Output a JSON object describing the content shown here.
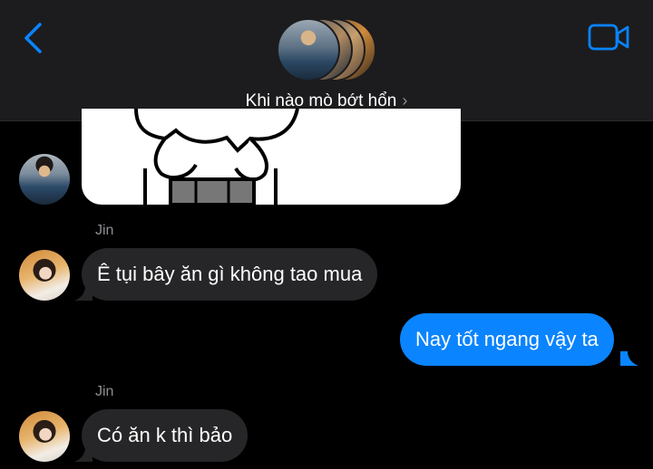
{
  "header": {
    "title": "Khi nào mò bớt hổn",
    "back_icon": "chevron-left-icon",
    "video_icon": "video-camera-icon",
    "accent": "#0a84ff"
  },
  "messages": [
    {
      "type": "image",
      "direction": "incoming",
      "avatar": "boy"
    },
    {
      "sender": "Jin",
      "text": "Ê tụi bây ăn gì không tao mua",
      "direction": "incoming",
      "avatar": "girl"
    },
    {
      "text": "Nay tốt ngang vậy ta",
      "direction": "outgoing"
    },
    {
      "sender": "Jin",
      "text": "Có ăn k thì bảo",
      "direction": "incoming",
      "avatar": "girl"
    }
  ]
}
